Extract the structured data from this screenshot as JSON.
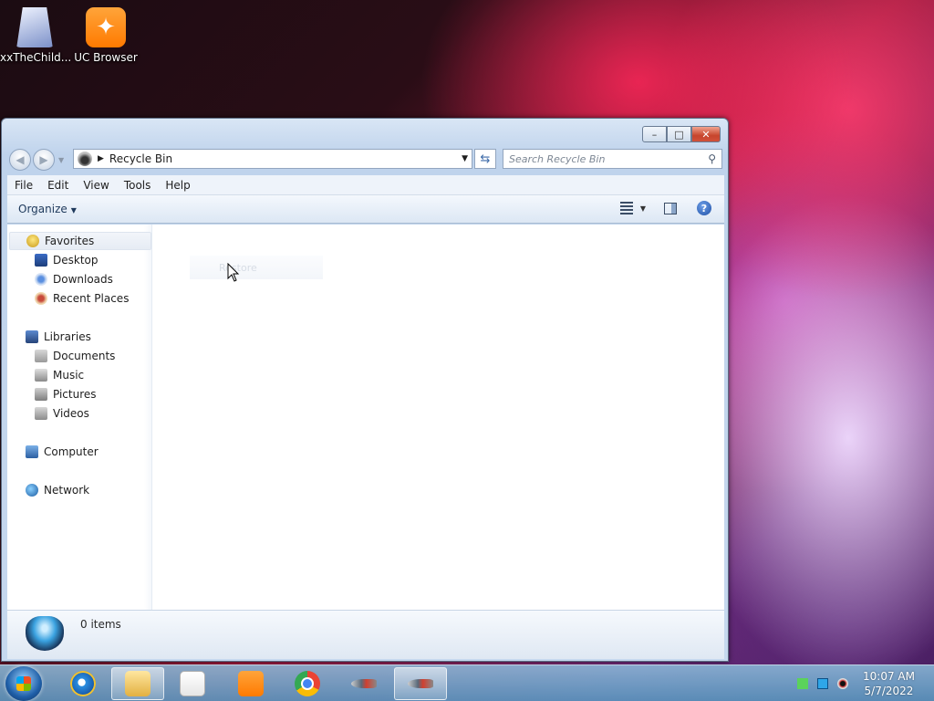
{
  "desktop": {
    "icons": [
      {
        "label": "xxTheChild..."
      },
      {
        "label": "UC Browser"
      }
    ]
  },
  "window": {
    "title": "Recycle Bin",
    "address": {
      "location": "Recycle Bin"
    },
    "search": {
      "placeholder": "Search Recycle Bin"
    },
    "menu": [
      "File",
      "Edit",
      "View",
      "Tools",
      "Help"
    ],
    "toolbar": {
      "organize": "Organize"
    },
    "nav": {
      "favorites": "Favorites",
      "favorites_items": [
        "Desktop",
        "Downloads",
        "Recent Places"
      ],
      "libraries": "Libraries",
      "libraries_items": [
        "Documents",
        "Music",
        "Pictures",
        "Videos"
      ],
      "computer": "Computer",
      "network": "Network"
    },
    "content": {
      "ghost_label": "Restore"
    },
    "status": {
      "items": "0 items"
    }
  },
  "taskbar": {
    "apps": [
      "Internet Explorer",
      "Windows Explorer",
      "Windows Media Player",
      "UC Browser",
      "Google Chrome",
      "Fish",
      "Fish"
    ],
    "clock": {
      "time": "10:07 AM",
      "date": "5/7/2022"
    }
  },
  "colors": {
    "close_button": "#c7452d",
    "accent": "#1d4fa6"
  }
}
